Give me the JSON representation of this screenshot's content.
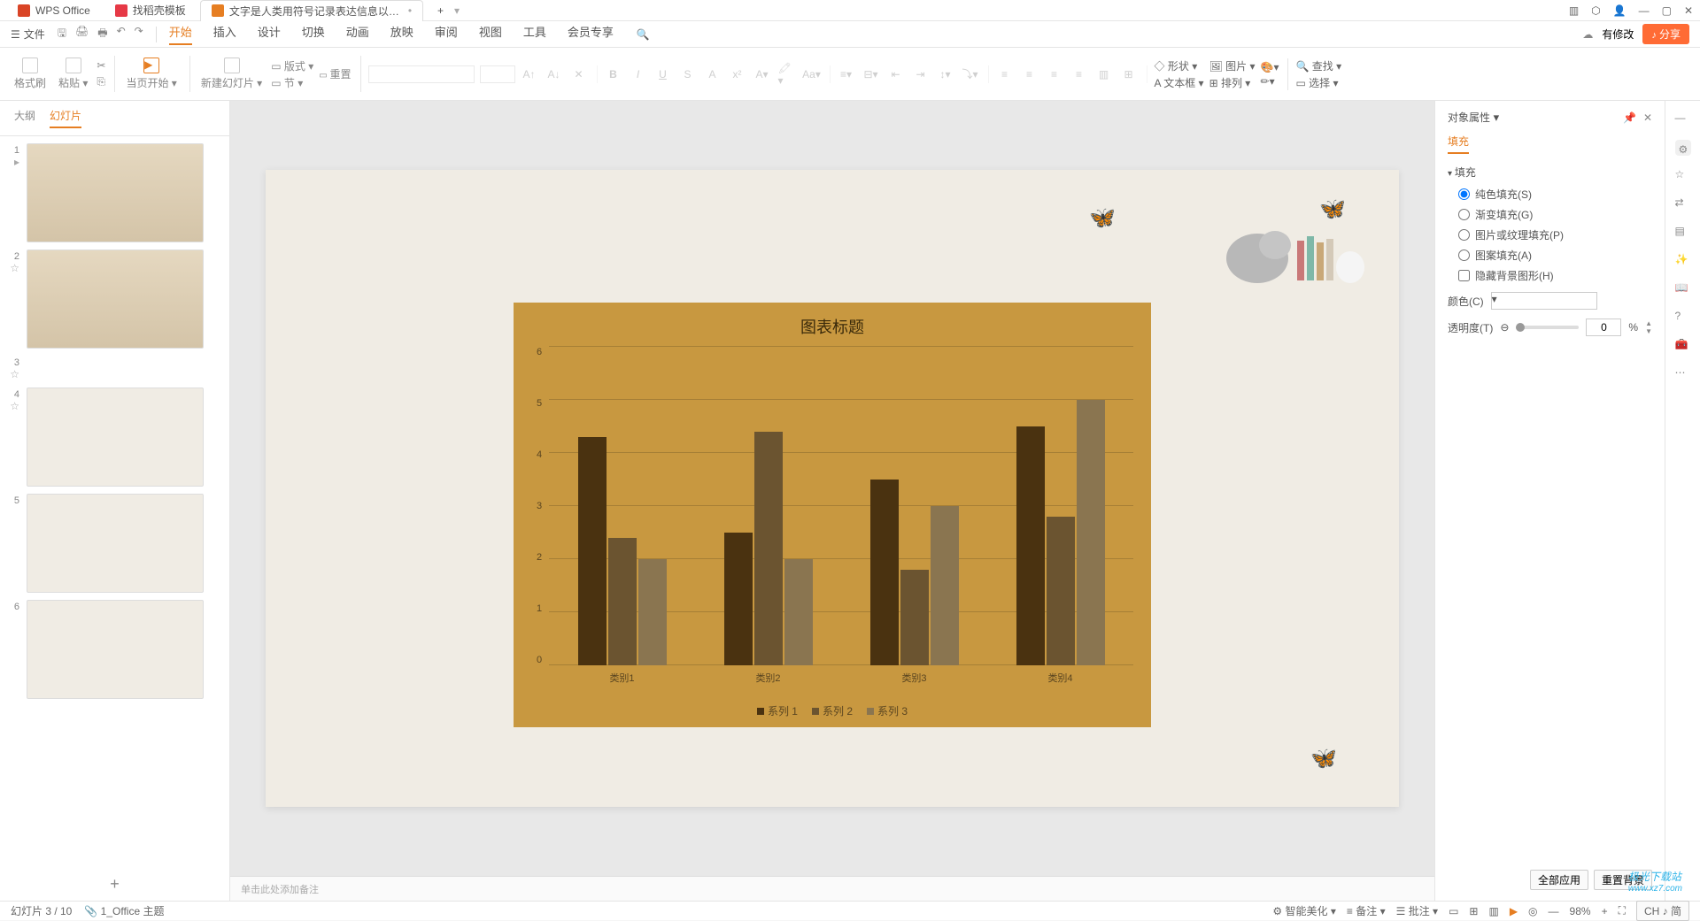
{
  "titlebar": {
    "tabs": [
      {
        "label": "WPS Office"
      },
      {
        "label": "找稻壳模板"
      },
      {
        "label": "文字是人类用符号记录表达信息以…"
      }
    ],
    "new_tab": "+"
  },
  "menubar": {
    "file": "文件",
    "items": [
      "开始",
      "插入",
      "设计",
      "切换",
      "动画",
      "放映",
      "审阅",
      "视图",
      "工具",
      "会员专享"
    ],
    "active": "开始",
    "has_changes": "有修改",
    "share": "分享"
  },
  "toolbar": {
    "format_painter": "格式刷",
    "paste": "粘贴",
    "play_current": "当页开始",
    "new_slide": "新建幻灯片",
    "layout": "版式",
    "reset": "重置",
    "section": "节",
    "find": "查找",
    "select": "选择",
    "shape": "形状",
    "picture": "图片",
    "textbox": "文本框",
    "arrange": "排列"
  },
  "left_panel": {
    "tabs": [
      "大纲",
      "幻灯片"
    ],
    "active": "幻灯片",
    "slide_count": 6,
    "selected": 3
  },
  "chart_data": {
    "type": "bar",
    "title": "图表标题",
    "categories": [
      "类别1",
      "类别2",
      "类别3",
      "类别4"
    ],
    "series": [
      {
        "name": "系列 1",
        "values": [
          4.3,
          2.5,
          3.5,
          4.5
        ]
      },
      {
        "name": "系列 2",
        "values": [
          2.4,
          4.4,
          1.8,
          2.8
        ]
      },
      {
        "name": "系列 3",
        "values": [
          2.0,
          2.0,
          3.0,
          5.0
        ]
      }
    ],
    "ylim": [
      0,
      6
    ],
    "yticks": [
      0,
      1,
      2,
      3,
      4,
      5,
      6
    ]
  },
  "notes_placeholder": "单击此处添加备注",
  "right_panel": {
    "title": "对象属性",
    "tab": "填充",
    "section": "填充",
    "options": {
      "solid": "纯色填充(S)",
      "gradient": "渐变填充(G)",
      "picture": "图片或纹理填充(P)",
      "pattern": "图案填充(A)",
      "hide_bg": "隐藏背景图形(H)"
    },
    "color_label": "颜色(C)",
    "transparency_label": "透明度(T)",
    "transparency_value": "0",
    "transparency_unit": "%",
    "apply_all": "全部应用",
    "reset_bg": "重置背景"
  },
  "statusbar": {
    "slide_info": "幻灯片 3 / 10",
    "theme": "1_Office 主题",
    "beautify": "智能美化",
    "notes": "备注",
    "comments": "批注",
    "zoom": "98%",
    "ime": "CH ♪ 简"
  },
  "watermark": {
    "line1": "极光下载站",
    "line2": "www.xz7.com"
  }
}
